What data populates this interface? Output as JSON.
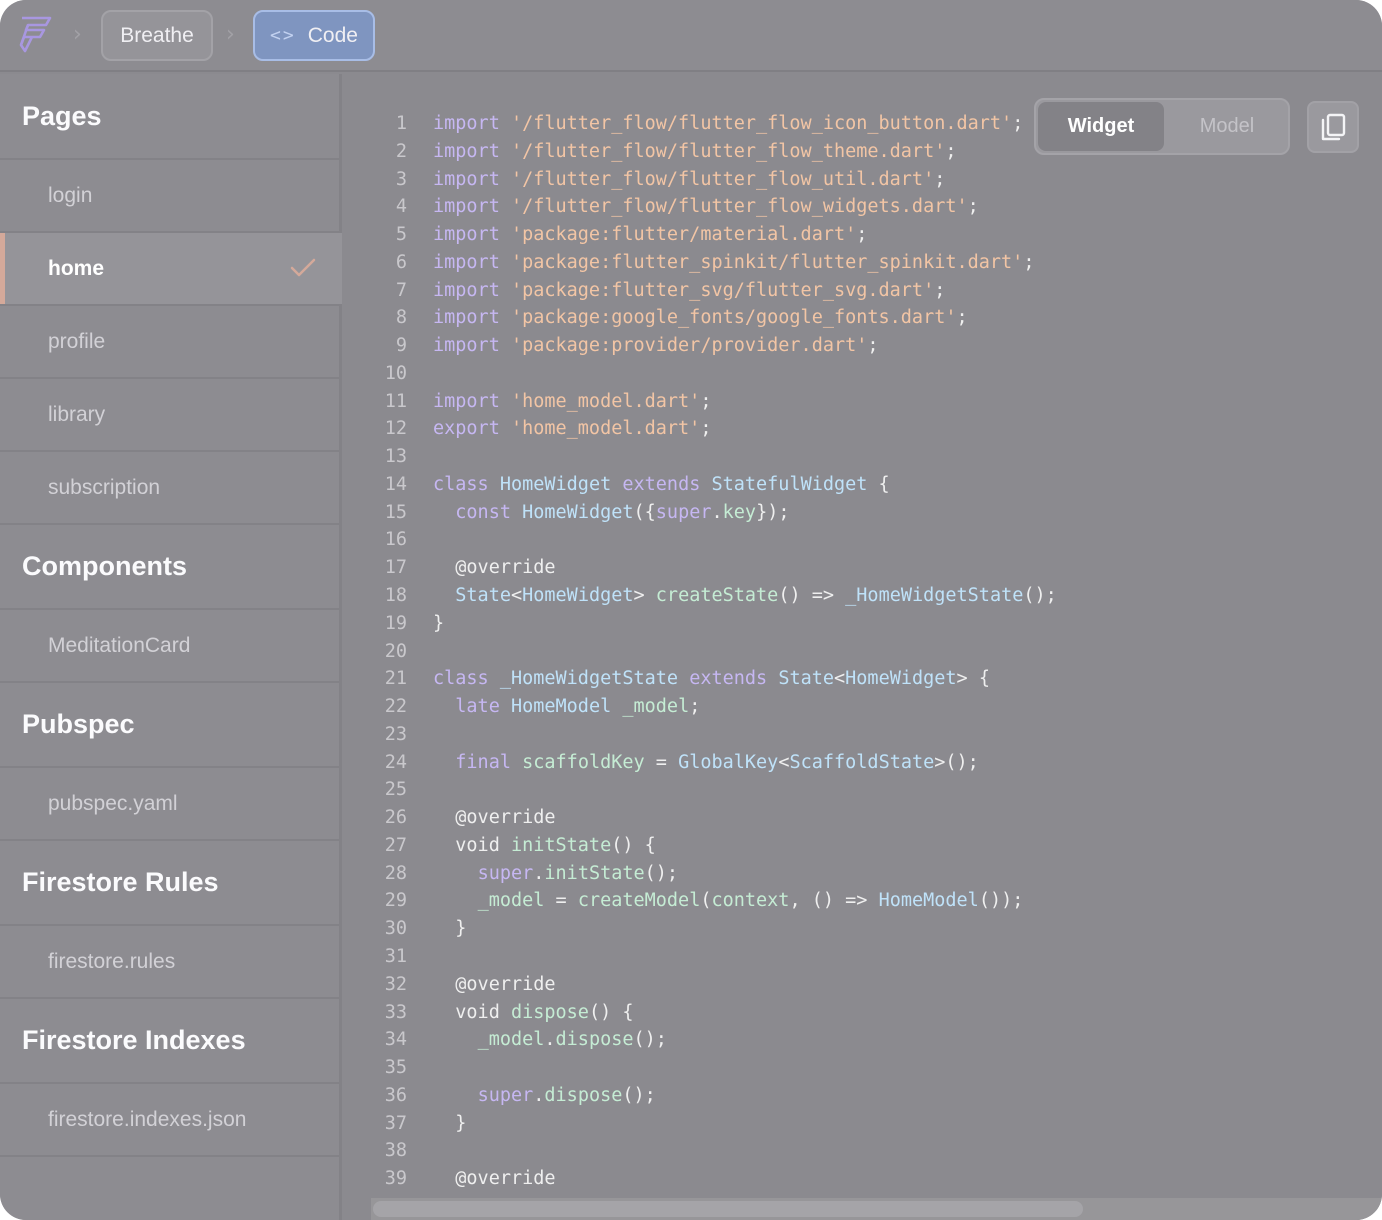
{
  "breadcrumb": {
    "project": "Breathe",
    "code_label": "Code",
    "code_glyph": "<>"
  },
  "sidebar": {
    "sections": [
      {
        "heading": "Pages",
        "items": [
          "login",
          "home",
          "profile",
          "library",
          "subscription"
        ]
      },
      {
        "heading": "Components",
        "items": [
          "MeditationCard"
        ]
      },
      {
        "heading": "Pubspec",
        "items": [
          "pubspec.yaml"
        ]
      },
      {
        "heading": "Firestore Rules",
        "items": [
          "firestore.rules"
        ]
      },
      {
        "heading": "Firestore Indexes",
        "items": [
          "firestore.indexes.json"
        ]
      }
    ],
    "active_item": "home"
  },
  "toggle": {
    "widget_label": "Widget",
    "model_label": "Model",
    "selected": "Widget"
  },
  "copy_button": {
    "icon": "copy-icon"
  },
  "colors": {
    "keyword": "#c6b7f2",
    "string": "#f2c5a5",
    "class": "#bfe2f9",
    "function": "#c5ecd4",
    "active_accent": "#d4a99a",
    "code_chip": "#7f95c0"
  },
  "code": {
    "lines": [
      [
        [
          "kw",
          "import"
        ],
        [
          "p",
          " "
        ],
        [
          "str",
          "'/flutter_flow/flutter_flow_icon_button.dart'"
        ],
        [
          "p",
          ";"
        ]
      ],
      [
        [
          "kw",
          "import"
        ],
        [
          "p",
          " "
        ],
        [
          "str",
          "'/flutter_flow/flutter_flow_theme.dart'"
        ],
        [
          "p",
          ";"
        ]
      ],
      [
        [
          "kw",
          "import"
        ],
        [
          "p",
          " "
        ],
        [
          "str",
          "'/flutter_flow/flutter_flow_util.dart'"
        ],
        [
          "p",
          ";"
        ]
      ],
      [
        [
          "kw",
          "import"
        ],
        [
          "p",
          " "
        ],
        [
          "str",
          "'/flutter_flow/flutter_flow_widgets.dart'"
        ],
        [
          "p",
          ";"
        ]
      ],
      [
        [
          "kw",
          "import"
        ],
        [
          "p",
          " "
        ],
        [
          "str",
          "'package:flutter/material.dart'"
        ],
        [
          "p",
          ";"
        ]
      ],
      [
        [
          "kw",
          "import"
        ],
        [
          "p",
          " "
        ],
        [
          "str",
          "'package:flutter_spinkit/flutter_spinkit.dart'"
        ],
        [
          "p",
          ";"
        ]
      ],
      [
        [
          "kw",
          "import"
        ],
        [
          "p",
          " "
        ],
        [
          "str",
          "'package:flutter_svg/flutter_svg.dart'"
        ],
        [
          "p",
          ";"
        ]
      ],
      [
        [
          "kw",
          "import"
        ],
        [
          "p",
          " "
        ],
        [
          "str",
          "'package:google_fonts/google_fonts.dart'"
        ],
        [
          "p",
          ";"
        ]
      ],
      [
        [
          "kw",
          "import"
        ],
        [
          "p",
          " "
        ],
        [
          "str",
          "'package:provider/provider.dart'"
        ],
        [
          "p",
          ";"
        ]
      ],
      [],
      [
        [
          "kw",
          "import"
        ],
        [
          "p",
          " "
        ],
        [
          "str",
          "'home_model.dart'"
        ],
        [
          "p",
          ";"
        ]
      ],
      [
        [
          "kw",
          "export"
        ],
        [
          "p",
          " "
        ],
        [
          "str",
          "'home_model.dart'"
        ],
        [
          "p",
          ";"
        ]
      ],
      [],
      [
        [
          "kw",
          "class"
        ],
        [
          "p",
          " "
        ],
        [
          "cls",
          "HomeWidget"
        ],
        [
          "p",
          " "
        ],
        [
          "kw",
          "extends"
        ],
        [
          "p",
          " "
        ],
        [
          "cls",
          "StatefulWidget"
        ],
        [
          "p",
          " {"
        ]
      ],
      [
        [
          "p",
          "  "
        ],
        [
          "kw",
          "const"
        ],
        [
          "p",
          " "
        ],
        [
          "cls",
          "HomeWidget"
        ],
        [
          "p",
          "({"
        ],
        [
          "kw",
          "super"
        ],
        [
          "p",
          "."
        ],
        [
          "fn",
          "key"
        ],
        [
          "p",
          "});"
        ]
      ],
      [],
      [
        [
          "p",
          "  @override"
        ]
      ],
      [
        [
          "p",
          "  "
        ],
        [
          "cls",
          "State"
        ],
        [
          "p",
          "<"
        ],
        [
          "cls",
          "HomeWidget"
        ],
        [
          "p",
          "> "
        ],
        [
          "fn",
          "createState"
        ],
        [
          "p",
          "() => "
        ],
        [
          "cls",
          "_HomeWidgetState"
        ],
        [
          "p",
          "();"
        ]
      ],
      [
        [
          "p",
          "}"
        ]
      ],
      [],
      [
        [
          "kw",
          "class"
        ],
        [
          "p",
          " "
        ],
        [
          "cls",
          "_HomeWidgetState"
        ],
        [
          "p",
          " "
        ],
        [
          "kw",
          "extends"
        ],
        [
          "p",
          " "
        ],
        [
          "cls",
          "State"
        ],
        [
          "p",
          "<"
        ],
        [
          "cls",
          "HomeWidget"
        ],
        [
          "p",
          "> {"
        ]
      ],
      [
        [
          "p",
          "  "
        ],
        [
          "kw",
          "late"
        ],
        [
          "p",
          " "
        ],
        [
          "cls",
          "HomeModel"
        ],
        [
          "p",
          " "
        ],
        [
          "fn",
          "_model"
        ],
        [
          "p",
          ";"
        ]
      ],
      [],
      [
        [
          "p",
          "  "
        ],
        [
          "kw",
          "final"
        ],
        [
          "p",
          " "
        ],
        [
          "fn",
          "scaffoldKey"
        ],
        [
          "p",
          " = "
        ],
        [
          "cls",
          "GlobalKey"
        ],
        [
          "p",
          "<"
        ],
        [
          "cls",
          "ScaffoldState"
        ],
        [
          "p",
          ">();"
        ]
      ],
      [],
      [
        [
          "p",
          "  @override"
        ]
      ],
      [
        [
          "p",
          "  void "
        ],
        [
          "fn",
          "initState"
        ],
        [
          "p",
          "() {"
        ]
      ],
      [
        [
          "p",
          "    "
        ],
        [
          "kw",
          "super"
        ],
        [
          "p",
          "."
        ],
        [
          "fn",
          "initState"
        ],
        [
          "p",
          "();"
        ]
      ],
      [
        [
          "p",
          "    "
        ],
        [
          "fn",
          "_model"
        ],
        [
          "p",
          " = "
        ],
        [
          "fn",
          "createModel"
        ],
        [
          "p",
          "("
        ],
        [
          "fn",
          "context"
        ],
        [
          "p",
          ", () => "
        ],
        [
          "cls",
          "HomeModel"
        ],
        [
          "p",
          "());"
        ]
      ],
      [
        [
          "p",
          "  }"
        ]
      ],
      [],
      [
        [
          "p",
          "  @override"
        ]
      ],
      [
        [
          "p",
          "  void "
        ],
        [
          "fn",
          "dispose"
        ],
        [
          "p",
          "() {"
        ]
      ],
      [
        [
          "p",
          "    "
        ],
        [
          "fn",
          "_model"
        ],
        [
          "p",
          "."
        ],
        [
          "fn",
          "dispose"
        ],
        [
          "p",
          "();"
        ]
      ],
      [],
      [
        [
          "p",
          "    "
        ],
        [
          "kw",
          "super"
        ],
        [
          "p",
          "."
        ],
        [
          "fn",
          "dispose"
        ],
        [
          "p",
          "();"
        ]
      ],
      [
        [
          "p",
          "  }"
        ]
      ],
      [],
      [
        [
          "p",
          "  @override"
        ]
      ]
    ]
  }
}
